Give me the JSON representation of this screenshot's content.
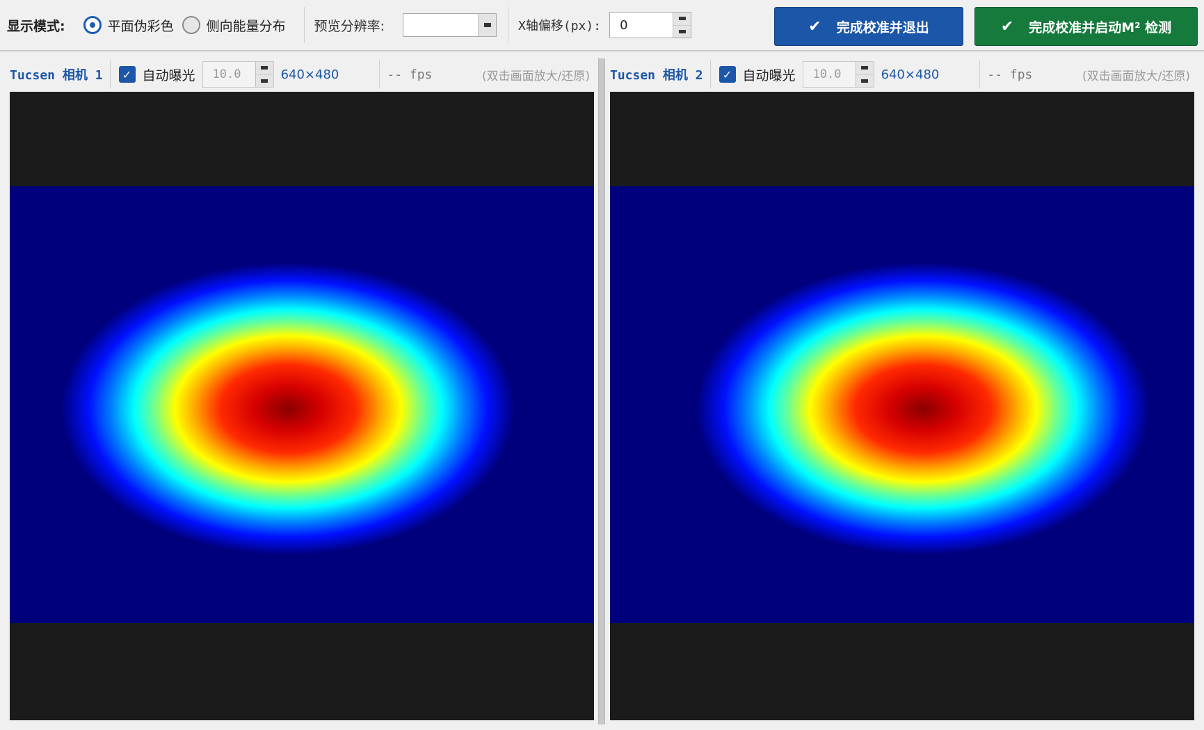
{
  "toolbar": {
    "display_mode_label": "显示模式:",
    "mode_options": [
      {
        "label": "平面伪彩色",
        "checked": true
      },
      {
        "label": "侧向能量分布",
        "checked": false
      }
    ],
    "preview_resolution_label": "预览分辨率:",
    "preview_resolution_value": "",
    "x_offset_label": "X轴偏移(px):",
    "x_offset_value": "0",
    "finish_exit_label": "完成校准并退出",
    "finish_start_label": "完成校准并启动M² 检测",
    "colors": {
      "blue_button": "#1b56a8",
      "green_button": "#157a3c"
    }
  },
  "cameras": [
    {
      "name": "Tucsen 相机 1",
      "auto_exposure_label": "自动曝光",
      "auto_exposure_checked": true,
      "exposure_value": "10.0",
      "resolution": "640×480",
      "fps": "-- fps",
      "hint": "(双击画面放大/还原)"
    },
    {
      "name": "Tucsen 相机 2",
      "auto_exposure_label": "自动曝光",
      "auto_exposure_checked": true,
      "exposure_value": "10.0",
      "resolution": "640×480",
      "fps": "-- fps",
      "hint": "(双击画面放大/还原)"
    }
  ],
  "icons": {
    "check_glyph": "✔",
    "checkbox_glyph": "✓"
  }
}
